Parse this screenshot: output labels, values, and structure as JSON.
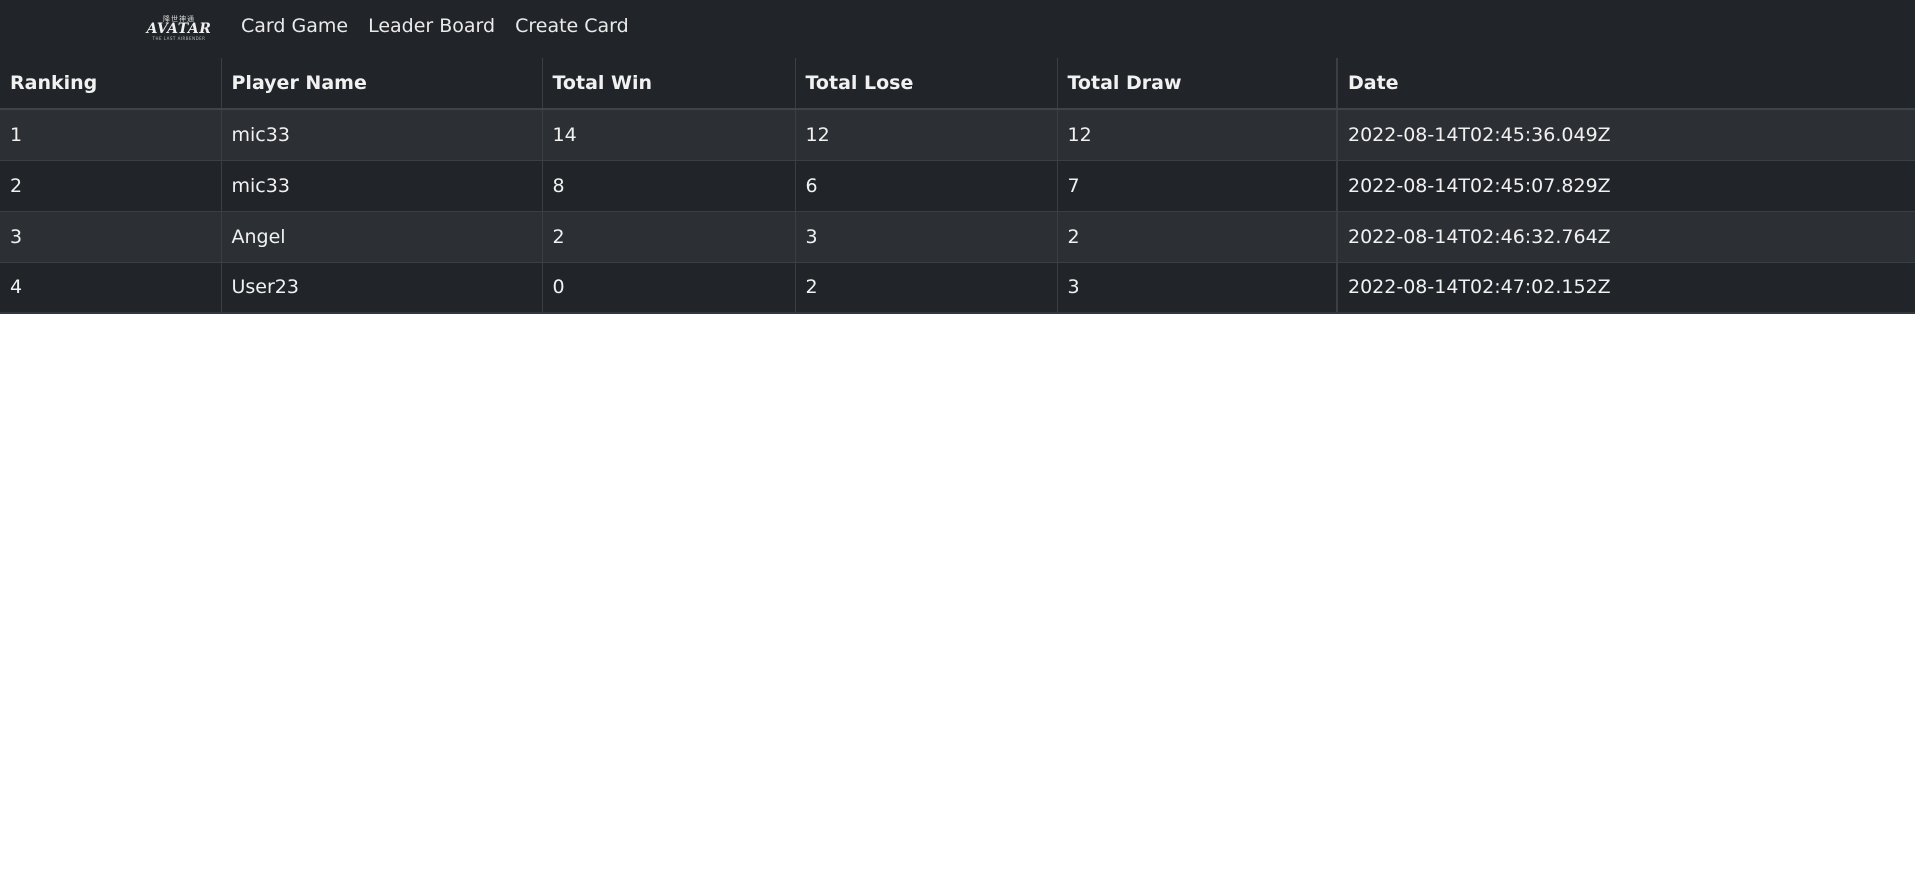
{
  "navbar": {
    "brand": {
      "glyphs": "降世神通",
      "word": "AVATAR",
      "subtitle": "THE LAST AIRBENDER"
    },
    "links": [
      {
        "label": "Card Game"
      },
      {
        "label": "Leader Board"
      },
      {
        "label": "Create Card"
      }
    ]
  },
  "leaderboard": {
    "columns": [
      "Ranking",
      "Player Name",
      "Total Win",
      "Total Lose",
      "Total Draw",
      "Date"
    ],
    "rows": [
      {
        "ranking": "1",
        "player": "mic33",
        "win": "14",
        "lose": "12",
        "draw": "12",
        "date": "2022-08-14T02:45:36.049Z"
      },
      {
        "ranking": "2",
        "player": "mic33",
        "win": "8",
        "lose": "6",
        "draw": "7",
        "date": "2022-08-14T02:45:07.829Z"
      },
      {
        "ranking": "3",
        "player": "Angel",
        "win": "2",
        "lose": "3",
        "draw": "2",
        "date": "2022-08-14T02:46:32.764Z"
      },
      {
        "ranking": "4",
        "player": "User23",
        "win": "0",
        "lose": "2",
        "draw": "3",
        "date": "2022-08-14T02:47:02.152Z"
      }
    ]
  },
  "colors": {
    "navbar_bg": "#212529",
    "table_bg": "#212529",
    "stripe_bg": "#2c3034",
    "text": "#f1f1f1",
    "page_bg": "#ffffff"
  }
}
